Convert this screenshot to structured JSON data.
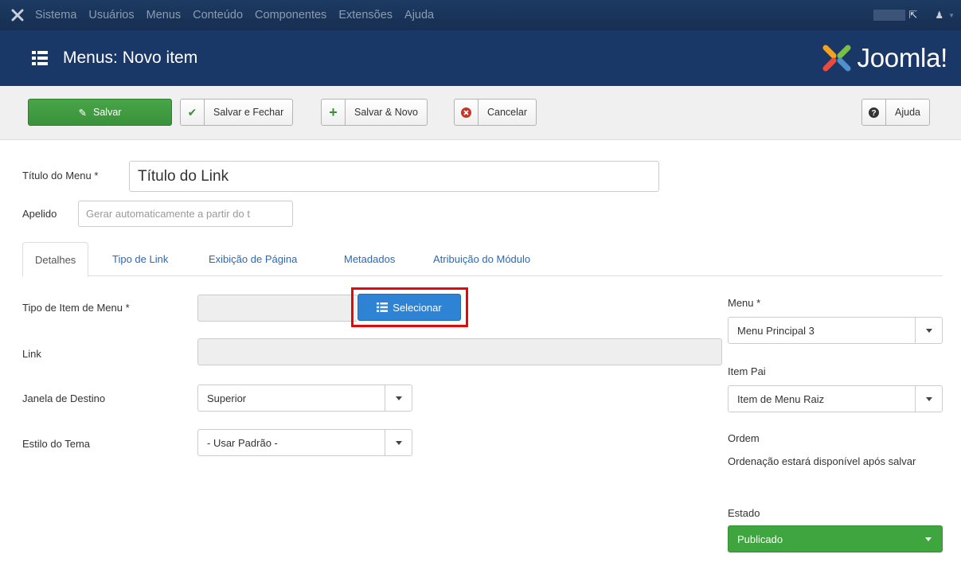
{
  "topnav": {
    "items": [
      "Sistema",
      "Usuários",
      "Menus",
      "Conteúdo",
      "Componentes",
      "Extensões",
      "Ajuda"
    ]
  },
  "header": {
    "title": "Menus: Novo item",
    "logo_text": "Joomla!"
  },
  "toolbar": {
    "save": "Salvar",
    "save_close": "Salvar e Fechar",
    "save_new": "Salvar & Novo",
    "cancel": "Cancelar",
    "help": "Ajuda"
  },
  "form": {
    "title_label": "Título do Menu *",
    "title_value": "Título do Link",
    "alias_label": "Apelido",
    "alias_placeholder": "Gerar automaticamente a partir do t"
  },
  "tabs": [
    "Detalhes",
    "Tipo de Link",
    "Exibição de Página",
    "Metadados",
    "Atribuição do Módulo"
  ],
  "details": {
    "item_type_label": "Tipo de Item de Menu *",
    "select_button": "Selecionar",
    "link_label": "Link",
    "target_label": "Janela de Destino",
    "target_value": "Superior",
    "template_label": "Estilo do Tema",
    "template_value": "- Usar Padrão -"
  },
  "sidebar": {
    "menu_label": "Menu *",
    "menu_value": "Menu Principal 3",
    "parent_label": "Item Pai",
    "parent_value": "Item de Menu Raiz",
    "order_label": "Ordem",
    "order_text": "Ordenação estará disponível após salvar",
    "status_label": "Estado",
    "status_value": "Publicado"
  },
  "colors": {
    "nav_bg": "#172f52",
    "header_bg": "#1a3867",
    "save_green": "#3f9e3f",
    "select_blue": "#2f83d4",
    "status_green": "#3fa63f",
    "highlight_red": "#e10b0b",
    "link_blue": "#2a69b8"
  }
}
